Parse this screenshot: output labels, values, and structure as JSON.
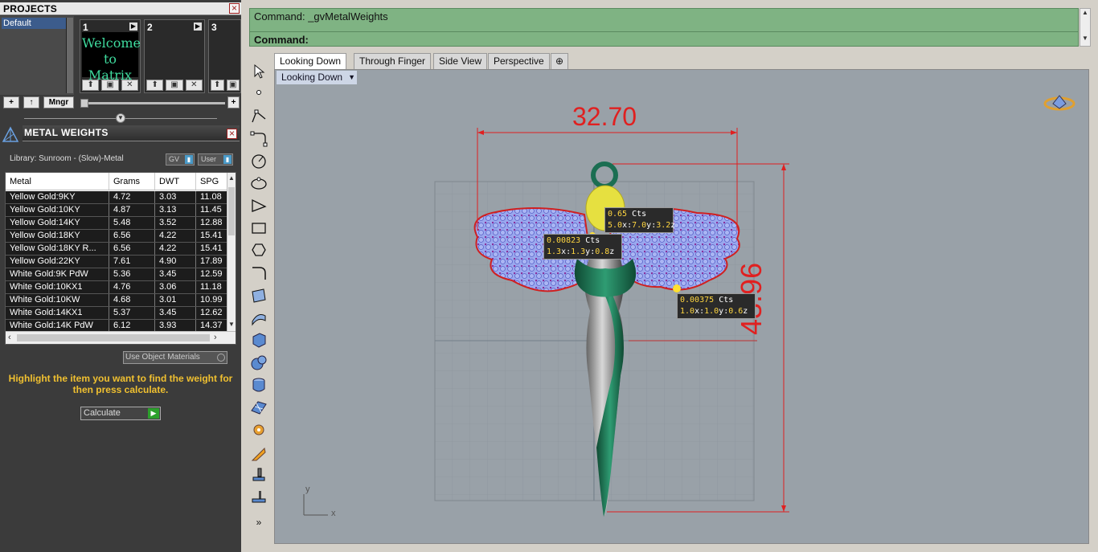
{
  "projects": {
    "title": "PROJECTS",
    "items": [
      "Default"
    ],
    "slots": [
      {
        "num": "1",
        "thumb_text": "Welcome to Matrix"
      },
      {
        "num": "2",
        "thumb_text": ""
      },
      {
        "num": "3",
        "thumb_text": ""
      }
    ],
    "add_label": "+",
    "up_label": "↑",
    "manager_label": "Mngr"
  },
  "metal_weights": {
    "title": "METAL WEIGHTS",
    "library": "Library: Sunroom - (Slow)-Metal",
    "gv_label": "GV",
    "user_label": "User",
    "columns": [
      "Metal",
      "Grams",
      "DWT",
      "SPG"
    ],
    "rows": [
      [
        "Yellow Gold:9KY",
        "4.72",
        "3.03",
        "11.08"
      ],
      [
        "Yellow Gold:10KY",
        "4.87",
        "3.13",
        "11.45"
      ],
      [
        "Yellow Gold:14KY",
        "5.48",
        "3.52",
        "12.88"
      ],
      [
        "Yellow Gold:18KY",
        "6.56",
        "4.22",
        "15.41"
      ],
      [
        "Yellow Gold:18KY R...",
        "6.56",
        "4.22",
        "15.41"
      ],
      [
        "Yellow Gold:22KY",
        "7.61",
        "4.90",
        "17.89"
      ],
      [
        "White Gold:9K PdW",
        "5.36",
        "3.45",
        "12.59"
      ],
      [
        "White Gold:10KX1",
        "4.76",
        "3.06",
        "11.18"
      ],
      [
        "White Gold:10KW",
        "4.68",
        "3.01",
        "10.99"
      ],
      [
        "White Gold:14KX1",
        "5.37",
        "3.45",
        "12.62"
      ],
      [
        "White Gold:14K PdW",
        "6.12",
        "3.93",
        "14.37"
      ]
    ],
    "use_object_materials": "Use Object Materials",
    "hint": "Highlight the item you want to find the weight for then press calculate.",
    "calculate_label": "Calculate"
  },
  "command": {
    "line1": "Command: _gvMetalWeights",
    "line2": "Command:"
  },
  "tabs": [
    "Looking Down",
    "Through Finger",
    "Side View",
    "Perspective"
  ],
  "viewport": {
    "title": "Looking Down",
    "dim_width": "32.70",
    "dim_height": "43.96",
    "axis_y": "y",
    "axis_x": "x",
    "stones": [
      {
        "cts": "0.65",
        "unit": "Cts",
        "x": "5.0",
        "y": "7.0",
        "z": "3.2"
      },
      {
        "cts": "0.00823",
        "unit": "Cts",
        "x": "1.3",
        "y": "1.3",
        "z": "0.8"
      },
      {
        "cts": "0.00375",
        "unit": "Cts",
        "x": "1.0",
        "y": "1.0",
        "z": "0.6"
      }
    ]
  },
  "colors": {
    "command_bg": "#7fb383",
    "viewport_bg": "#99a1a8",
    "dimension": "#e02020",
    "hint_text": "#f0c030"
  }
}
